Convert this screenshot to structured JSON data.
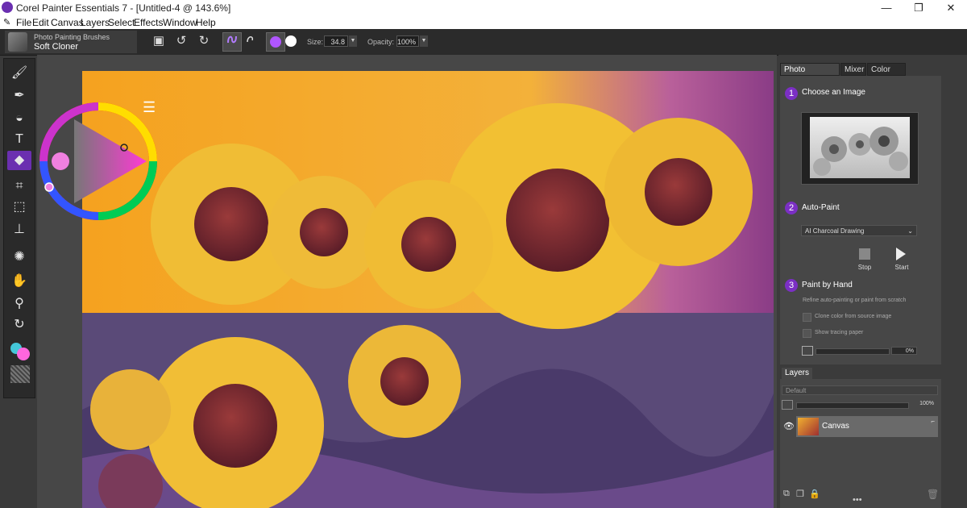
{
  "window": {
    "title": "Corel Painter Essentials 7 - [Untitled-4 @ 143.6%]",
    "controls": [
      "—",
      "❐",
      "✕"
    ]
  },
  "menu": [
    "File",
    "Edit",
    "Canvas",
    "Layers",
    "Select",
    "Effects",
    "Window",
    "Help"
  ],
  "property_bar": {
    "brush_category": "Photo Painting Brushes",
    "brush_name": "Soft Cloner",
    "size_label": "Size:",
    "size_value": "34.8",
    "opacity_label": "Opacity:",
    "opacity_value": "100%"
  },
  "toolbox": {
    "tools": [
      "brush-tool",
      "dropper-tool",
      "paint-bucket-tool",
      "text-tool",
      "eraser-tool",
      "crop-tool",
      "rect-select-tool",
      "cloner-tool",
      "kaleidoscope-tool",
      "grabber-tool",
      "magnifier-tool",
      "rotate-page-tool"
    ],
    "selected": "eraser-tool",
    "main_color": "#ff66dd",
    "additional_color": "#44c6d8"
  },
  "color_wheel": {
    "selected_color": "#f080e0"
  },
  "panel": {
    "tabs": [
      "Photo Painting",
      "Mixer",
      "Color Set"
    ],
    "active_tab": "Photo Painting",
    "step1": {
      "number": "1",
      "title": "Choose an Image"
    },
    "step2": {
      "number": "2",
      "title": "Auto-Paint",
      "style": "AI Charcoal Drawing",
      "stop_label": "Stop",
      "start_label": "Start"
    },
    "step3": {
      "number": "3",
      "title": "Paint by Hand",
      "description": "Refine auto-painting or paint from scratch",
      "clone_color_label": "Clone color from source image",
      "tracing_label": "Show tracing paper",
      "opacity_value": "0%"
    }
  },
  "layers": {
    "tab_label": "Layers",
    "composite": "Default",
    "opacity_value": "100%",
    "items": [
      {
        "name": "Canvas"
      }
    ]
  },
  "colors": {
    "accent": "#7b2fc4",
    "sky": "#f5a623",
    "petal": "#f2c033",
    "center": "#7a2a2a"
  }
}
